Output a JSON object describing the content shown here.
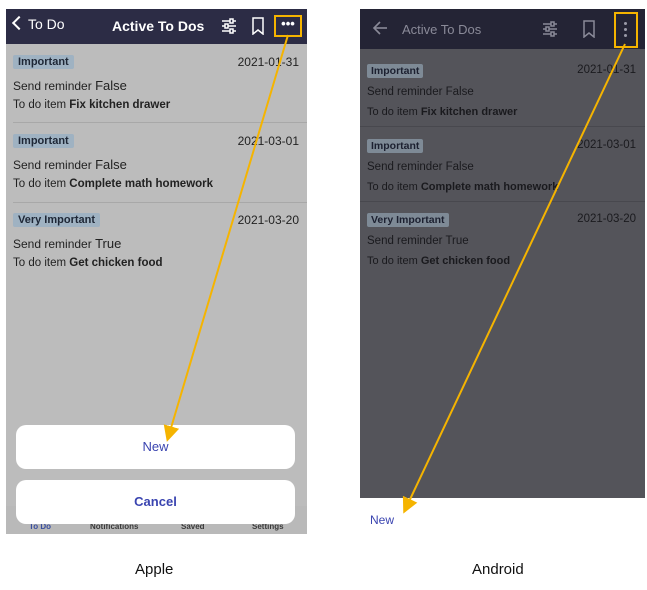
{
  "apple": {
    "caption": "Apple",
    "header": {
      "back_label": "To Do",
      "title": "Active To Dos"
    },
    "icons": [
      "back-chevron-icon",
      "filter-sliders-icon",
      "bookmark-icon",
      "more-horizontal-icon"
    ],
    "items": [
      {
        "badge": "Important",
        "date": "2021-01-31",
        "reminder_label": "Send reminder",
        "reminder_value": "False",
        "todo_label": "To do item",
        "todo_value": "Fix kitchen drawer"
      },
      {
        "badge": "Important",
        "date": "2021-03-01",
        "reminder_label": "Send reminder",
        "reminder_value": "False",
        "todo_label": "To do item",
        "todo_value": "Complete math homework"
      },
      {
        "badge": "Very Important",
        "date": "2021-03-20",
        "reminder_label": "Send reminder",
        "reminder_value": "True",
        "todo_label": "To do item",
        "todo_value": "Get chicken food"
      }
    ],
    "sheet": {
      "new_label": "New",
      "cancel_label": "Cancel"
    },
    "tabs": [
      "To Do",
      "Notifications",
      "Saved",
      "Settings"
    ]
  },
  "android": {
    "caption": "Android",
    "header": {
      "title": "Active To Dos"
    },
    "icons": [
      "back-arrow-icon",
      "filter-sliders-icon",
      "bookmark-icon",
      "more-vertical-icon"
    ],
    "items": [
      {
        "badge": "Important",
        "date": "2021-01-31",
        "reminder_label": "Send reminder",
        "reminder_value": "False",
        "todo_label": "To do item",
        "todo_value": "Fix kitchen drawer"
      },
      {
        "badge": "Important",
        "date": "2021-03-01",
        "reminder_label": "Send reminder",
        "reminder_value": "False",
        "todo_label": "To do item",
        "todo_value": "Complete math homework"
      },
      {
        "badge": "Very Important",
        "date": "2021-03-20",
        "reminder_label": "Send reminder",
        "reminder_value": "True",
        "todo_label": "To do item",
        "todo_value": "Get chicken food"
      }
    ],
    "menu": {
      "new_label": "New"
    }
  },
  "colors": {
    "header_bg": "#2c2c45",
    "accent_link": "#3a44b0",
    "highlight_arrow": "#f5b400",
    "badge_bg": "#9fb2c2"
  }
}
